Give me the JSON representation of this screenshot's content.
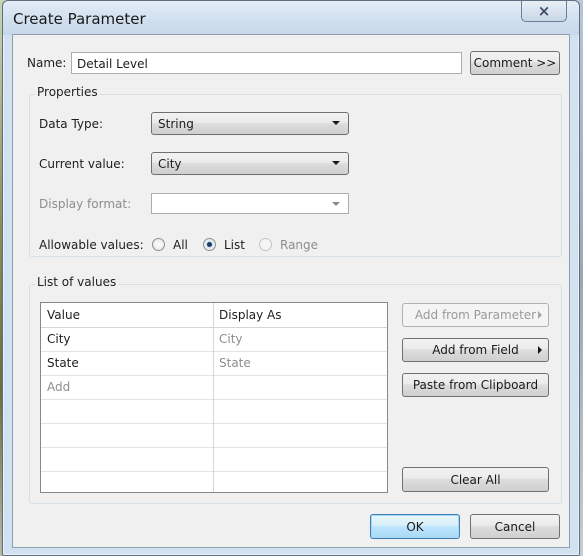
{
  "dialog": {
    "title": "Create Parameter",
    "close_label": "×"
  },
  "name": {
    "label": "Name:",
    "value": "Detail Level",
    "comment_button": "Comment >>"
  },
  "properties": {
    "title": "Properties",
    "data_type_label": "Data Type:",
    "data_type_value": "String",
    "current_value_label": "Current value:",
    "current_value": "City",
    "display_format_label": "Display format:",
    "display_format_value": "",
    "allowable_label": "Allowable values:",
    "allowable_options": [
      "All",
      "List",
      "Range"
    ],
    "allowable_selected": "List"
  },
  "list_of_values": {
    "title": "List of values",
    "columns": [
      "Value",
      "Display As"
    ],
    "rows": [
      {
        "value": "City",
        "display": "City"
      },
      {
        "value": "State",
        "display": "State"
      }
    ],
    "add_placeholder": "Add",
    "buttons": {
      "add_from_parameter": "Add from Parameter",
      "add_from_field": "Add from Field",
      "paste_from_clipboard": "Paste from Clipboard",
      "clear_all": "Clear All"
    }
  },
  "footer": {
    "ok": "OK",
    "cancel": "Cancel"
  }
}
